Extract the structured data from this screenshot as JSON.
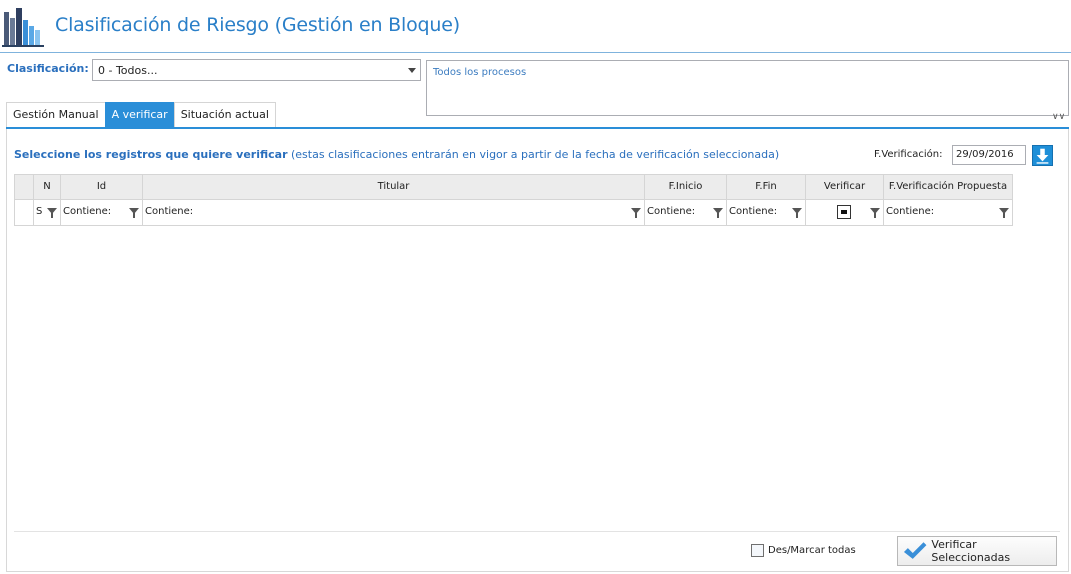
{
  "header": {
    "title": "Clasificación de Riesgo (Gestión en Bloque)",
    "icon": "building-chart-icon"
  },
  "clasificacion": {
    "label": "Clasificación:",
    "selected": "0 - Todos...",
    "procesos_text": "Todos los procesos"
  },
  "tabs": [
    {
      "label": "Gestión Manual",
      "active": false
    },
    {
      "label": "A verificar",
      "active": true
    },
    {
      "label": "Situación actual",
      "active": false
    }
  ],
  "instructions": {
    "bold": "Seleccione los registros que quiere verificar",
    "normal": " (estas clasificaciones entrarán en vigor a partir de la fecha de verificación seleccionada)"
  },
  "fverificacion": {
    "label": "F.Verificación:",
    "value": "29/09/2016"
  },
  "grid": {
    "columns": [
      {
        "key": "blank",
        "header": "",
        "filter": ""
      },
      {
        "key": "n",
        "header": "N",
        "filter": "S"
      },
      {
        "key": "id",
        "header": "Id",
        "filter": "Contiene:"
      },
      {
        "key": "titular",
        "header": "Titular",
        "filter": "Contiene:"
      },
      {
        "key": "finicio",
        "header": "F.Inicio",
        "filter": "Contiene:"
      },
      {
        "key": "ffin",
        "header": "F.Fin",
        "filter": "Contiene:"
      },
      {
        "key": "verificar",
        "header": "Verificar",
        "filter": ""
      },
      {
        "key": "fverprop",
        "header": "F.Verificación Propuesta",
        "filter": "Contiene:"
      }
    ]
  },
  "footer": {
    "desmarcar_label": "Des/Marcar todas",
    "verify_button_label": "Verificar Seleccionadas"
  },
  "colors": {
    "accent": "#2a8ed8",
    "title": "#2a7fc8",
    "label_blue": "#2a6fbd"
  }
}
